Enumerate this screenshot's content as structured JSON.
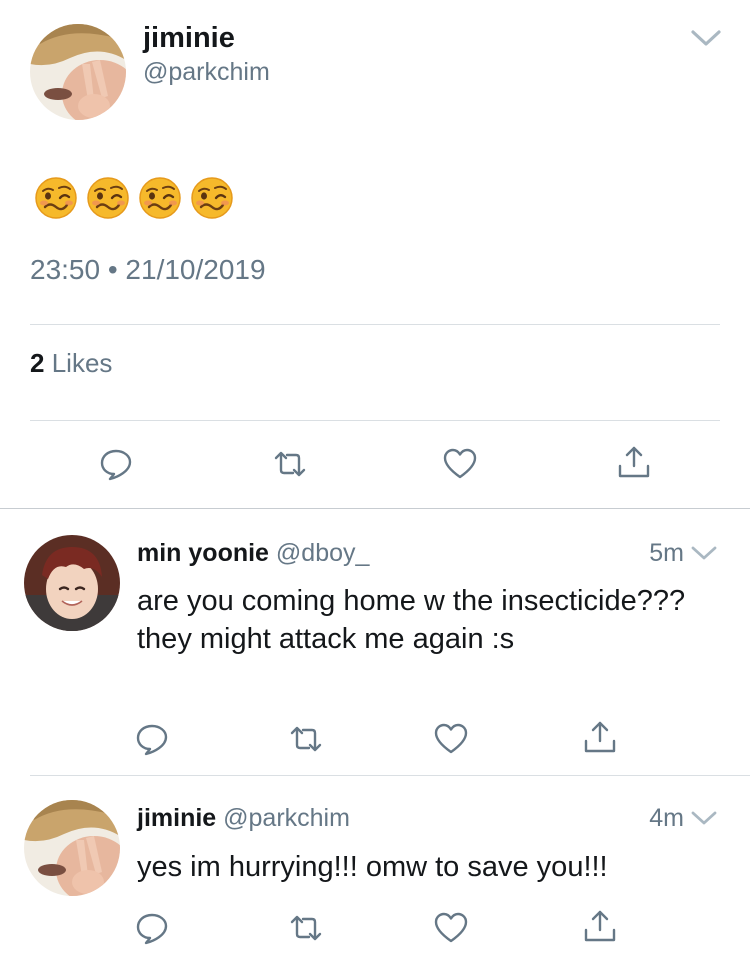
{
  "main_tweet": {
    "name": "jiminie",
    "handle": "@parkchim",
    "emoji": [
      "woozy-face",
      "woozy-face",
      "woozy-face",
      "woozy-face"
    ],
    "timestamp": "23:50 • 21/10/2019",
    "likes_count": "2",
    "likes_label": "Likes",
    "actions": [
      "reply-icon",
      "retweet-icon",
      "like-icon",
      "share-icon"
    ]
  },
  "replies": [
    {
      "name": "min yoonie",
      "handle": "@dboy_",
      "time": "5m",
      "text": "are you coming home w the insecticide??? they might attack me again :s"
    },
    {
      "name": "jiminie",
      "handle": "@parkchim",
      "time": "4m",
      "text": "yes im hurrying!!! omw to save you!!!"
    }
  ],
  "colors": {
    "text_primary": "#14171a",
    "text_secondary": "#657786",
    "divider": "#dadfe3",
    "icon": "#657786"
  }
}
